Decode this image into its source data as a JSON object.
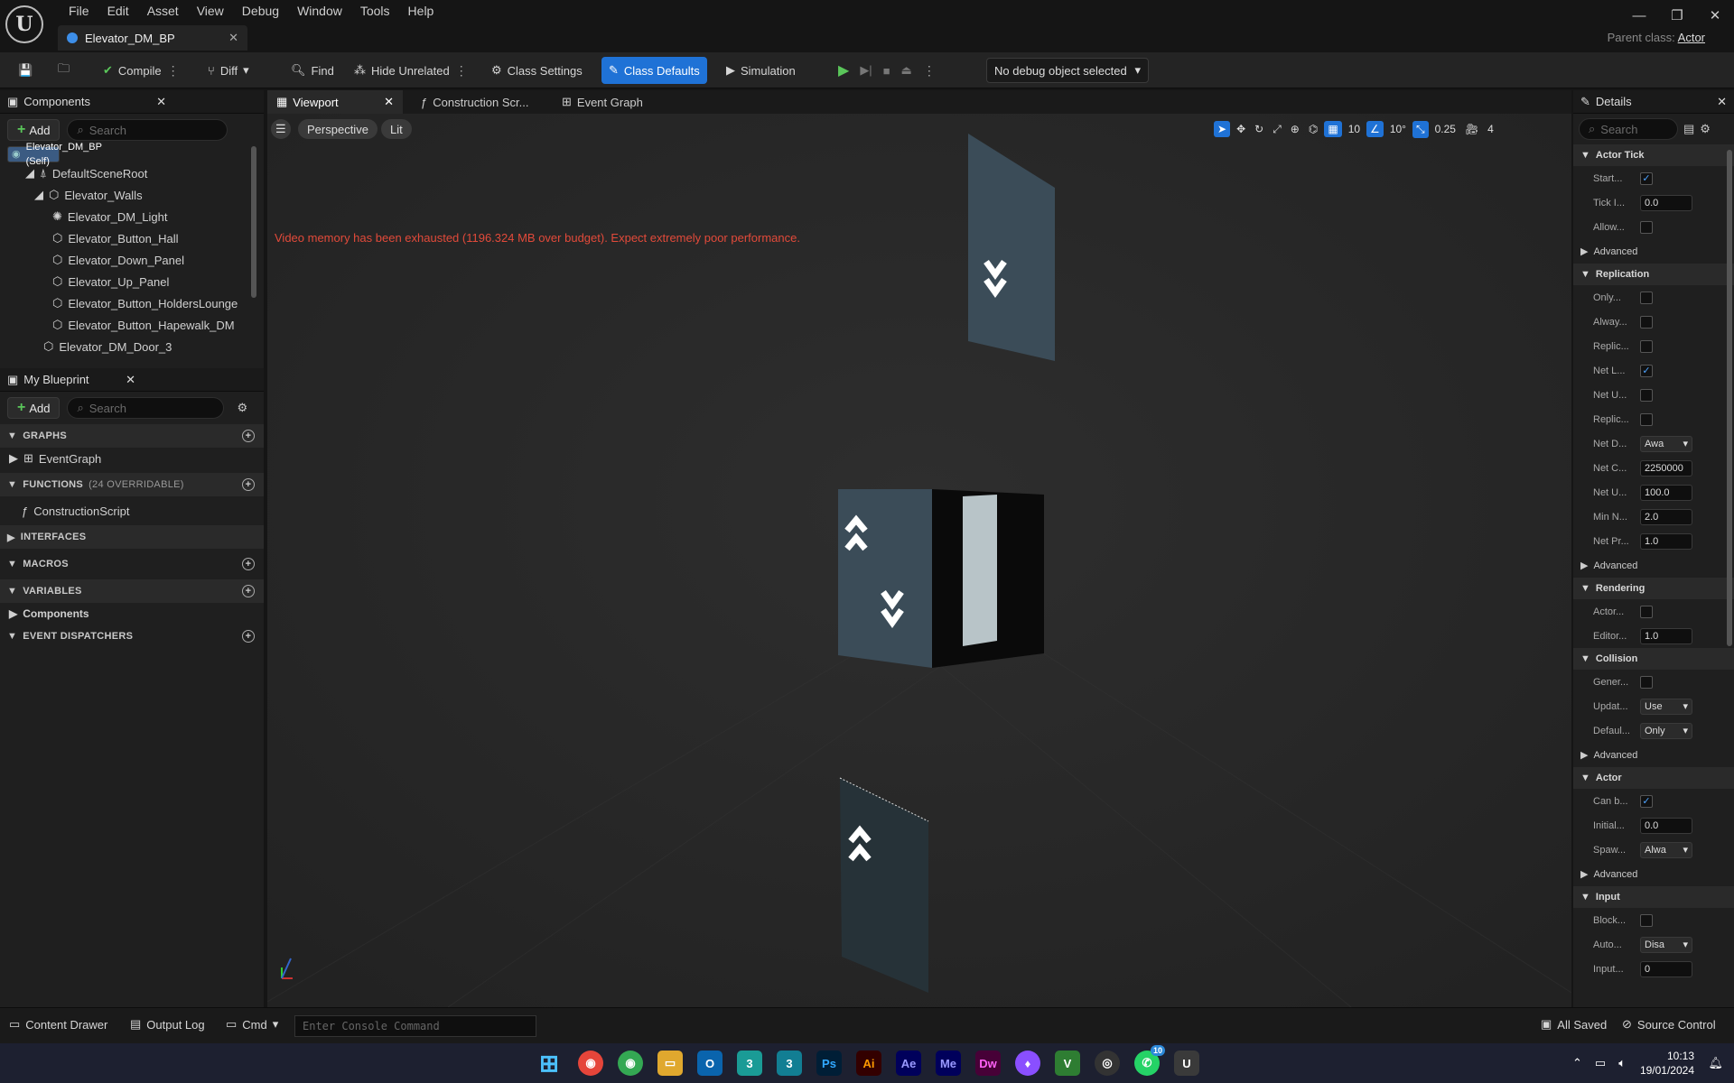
{
  "menu": [
    "File",
    "Edit",
    "Asset",
    "View",
    "Debug",
    "Window",
    "Tools",
    "Help"
  ],
  "doc_tab": "Elevator_DM_BP",
  "parent_class": {
    "label": "Parent class:",
    "value": "Actor"
  },
  "toolbar": {
    "compile": "Compile",
    "diff": "Diff",
    "find": "Find",
    "hide_unrelated": "Hide Unrelated",
    "class_settings": "Class Settings",
    "class_defaults": "Class Defaults",
    "simulation": "Simulation",
    "debug_object": "No debug object selected"
  },
  "components": {
    "title": "Components",
    "add": "Add",
    "search_placeholder": "Search",
    "tree": [
      "Elevator_DM_BP (Self)",
      "DefaultSceneRoot",
      "Elevator_Walls",
      "Elevator_DM_Light",
      "Elevator_Button_Hall",
      "Elevator_Down_Panel",
      "Elevator_Up_Panel",
      "Elevator_Button_HoldersLounge",
      "Elevator_Button_Hapewalk_DM",
      "Elevator_DM_Door_3"
    ]
  },
  "my_blueprint": {
    "title": "My Blueprint",
    "add": "Add",
    "search_placeholder": "Search",
    "graphs": "GRAPHS",
    "event_graph": "EventGraph",
    "functions": "FUNCTIONS",
    "functions_count": "(24 OVERRIDABLE)",
    "construction_script": "ConstructionScript",
    "interfaces": "INTERFACES",
    "macros": "MACROS",
    "variables": "VARIABLES",
    "components_cat": "Components",
    "event_dispatchers": "EVENT DISPATCHERS"
  },
  "viewport": {
    "tabs": [
      "Viewport",
      "Construction Scr...",
      "Event Graph"
    ],
    "perspective": "Perspective",
    "lit": "Lit",
    "grid": "10",
    "angle": "10°",
    "scale": "0.25",
    "cam": "4",
    "warning": "Video memory has been exhausted (1196.324 MB over budget). Expect extremely poor performance."
  },
  "details": {
    "title": "Details",
    "search_placeholder": "Search",
    "sections": [
      {
        "name": "Actor Tick",
        "rows": [
          {
            "l": "Start...",
            "t": "chk",
            "v": true
          },
          {
            "l": "Tick I...",
            "t": "num",
            "v": "0.0"
          },
          {
            "l": "Allow...",
            "t": "chk",
            "v": false
          }
        ],
        "advanced": true
      },
      {
        "name": "Replication",
        "rows": [
          {
            "l": "Only...",
            "t": "chk",
            "v": false
          },
          {
            "l": "Alway...",
            "t": "chk",
            "v": false
          },
          {
            "l": "Replic...",
            "t": "chk",
            "v": false
          },
          {
            "l": "Net L...",
            "t": "chk",
            "v": true
          },
          {
            "l": "Net U...",
            "t": "chk",
            "v": false
          },
          {
            "l": "Replic...",
            "t": "chk",
            "v": false
          },
          {
            "l": "Net D...",
            "t": "sel",
            "v": "Awa"
          },
          {
            "l": "Net C...",
            "t": "num",
            "v": "2250000"
          },
          {
            "l": "Net U...",
            "t": "num",
            "v": "100.0"
          },
          {
            "l": "Min N...",
            "t": "num",
            "v": "2.0"
          },
          {
            "l": "Net Pr...",
            "t": "num",
            "v": "1.0"
          }
        ],
        "advanced": true
      },
      {
        "name": "Rendering",
        "rows": [
          {
            "l": "Actor...",
            "t": "chk",
            "v": false
          },
          {
            "l": "Editor...",
            "t": "num",
            "v": "1.0"
          }
        ],
        "advanced": false
      },
      {
        "name": "Collision",
        "rows": [
          {
            "l": "Gener...",
            "t": "chk",
            "v": false
          },
          {
            "l": "Updat...",
            "t": "sel",
            "v": "Use"
          },
          {
            "l": "Defaul...",
            "t": "sel",
            "v": "Only"
          }
        ],
        "advanced": true
      },
      {
        "name": "Actor",
        "rows": [
          {
            "l": "Can b...",
            "t": "chk",
            "v": true
          },
          {
            "l": "Initial...",
            "t": "num",
            "v": "0.0"
          },
          {
            "l": "Spaw...",
            "t": "sel",
            "v": "Alwa"
          }
        ],
        "advanced": true
      },
      {
        "name": "Input",
        "rows": [
          {
            "l": "Block...",
            "t": "chk",
            "v": false
          },
          {
            "l": "Auto...",
            "t": "sel",
            "v": "Disa"
          },
          {
            "l": "Input...",
            "t": "num",
            "v": "0"
          }
        ],
        "advanced": false
      }
    ],
    "advanced_label": "Advanced"
  },
  "statusbar": {
    "content_drawer": "Content Drawer",
    "output_log": "Output Log",
    "cmd": "Cmd",
    "console_placeholder": "Enter Console Command",
    "all_saved": "All Saved",
    "source_control": "Source Control"
  },
  "taskbar": {
    "apps": [
      {
        "t": "Ps",
        "c": "#31a8ff",
        "bg": "#001e36"
      },
      {
        "t": "Ai",
        "c": "#ff9a00",
        "bg": "#330000"
      },
      {
        "t": "Ae",
        "c": "#9999ff",
        "bg": "#00005b"
      },
      {
        "t": "Me",
        "c": "#9999ff",
        "bg": "#00005b"
      },
      {
        "t": "Dw",
        "c": "#ff61f6",
        "bg": "#470137"
      }
    ],
    "whatsapp_badge": "10",
    "time": "10:13",
    "date": "19/01/2024"
  }
}
